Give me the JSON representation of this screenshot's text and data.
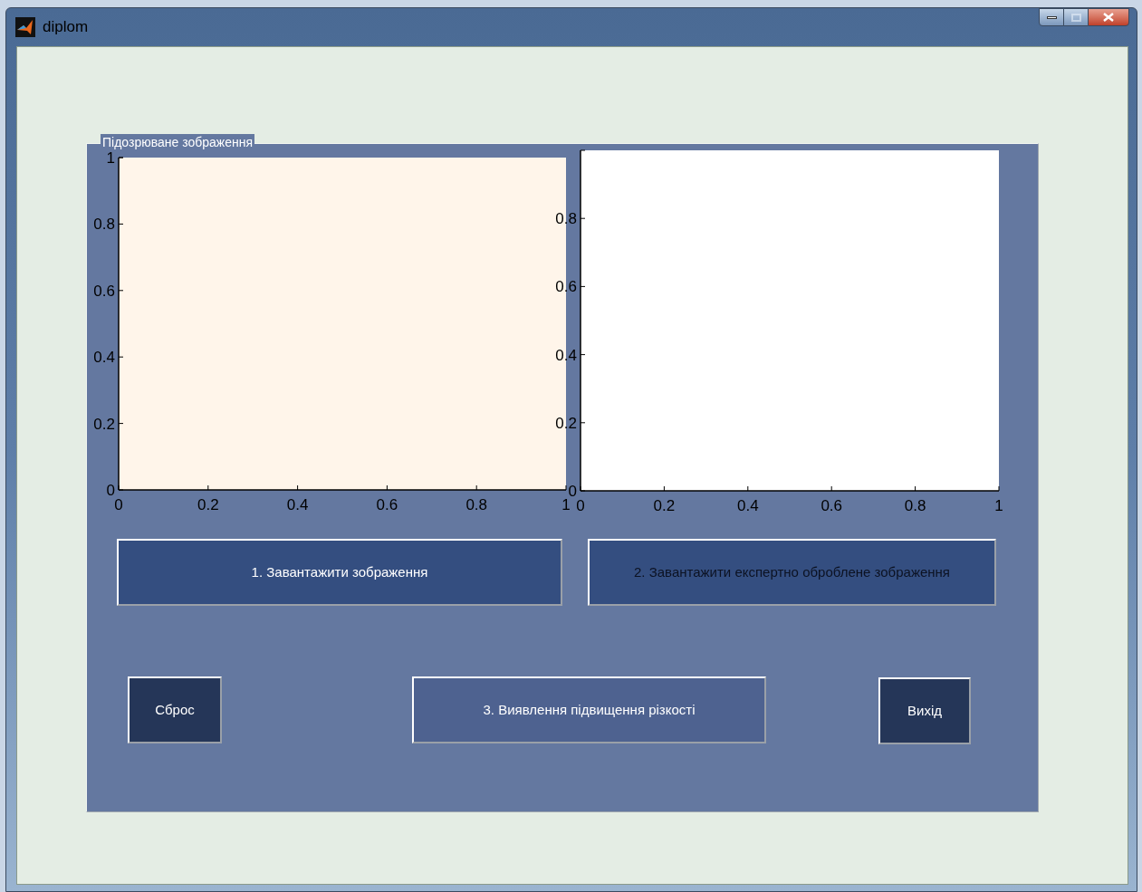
{
  "window": {
    "title": "diplom"
  },
  "panel": {
    "title": "Підозрюване зображення",
    "charts": [
      {
        "chart_data": {
          "type": "line",
          "xlim": [
            0,
            1
          ],
          "ylim": [
            0,
            1
          ],
          "xticks": [
            0,
            0.2,
            0.4,
            0.6,
            0.8,
            1
          ],
          "yticks": [
            0,
            0.2,
            0.4,
            0.6,
            0.8,
            1
          ]
        }
      },
      {
        "chart_data": {
          "type": "line",
          "xlim": [
            0,
            1
          ],
          "ylim": [
            0,
            1
          ],
          "xticks": [
            0,
            0.2,
            0.4,
            0.6,
            0.8,
            1
          ],
          "yticks": [
            0,
            0.2,
            0.4,
            0.6,
            0.8
          ]
        }
      }
    ],
    "button_rows": [
      [
        {
          "label": "1.  Завантажити зображення",
          "kind": "load"
        },
        {
          "label": "2. Завантажити експертно оброблене зображення",
          "kind": "load-dark-text"
        }
      ],
      [
        {
          "label": "Сброс",
          "kind": "small"
        },
        {
          "label": "3. Виявлення підвищення різкості",
          "kind": "detect"
        },
        {
          "label": "Вихід",
          "kind": "small"
        }
      ]
    ]
  }
}
